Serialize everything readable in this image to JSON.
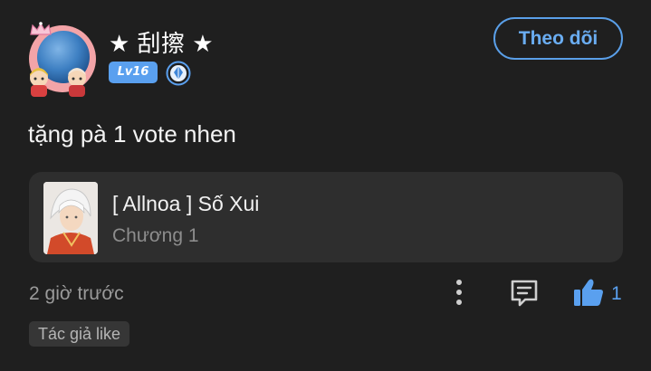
{
  "user": {
    "name": "★ 刮擦 ★",
    "level": "Lv16",
    "avatar_icon": "user-avatar",
    "badge_icon": "vip-badge-icon"
  },
  "follow_button": {
    "label": "Theo dõi"
  },
  "comment": {
    "text": "tặng pà 1 vote nhen"
  },
  "linked_chapter": {
    "title": "[ Allnoa ] Số Xui",
    "chapter": "Chương 1"
  },
  "footer": {
    "time": "2 giờ trước",
    "like_count": "1",
    "tag": "Tác giả like"
  },
  "colors": {
    "background": "#1f1f1f",
    "accent": "#5aa0ef",
    "card": "#2e2e2e",
    "muted_text": "#9a9a9a"
  }
}
